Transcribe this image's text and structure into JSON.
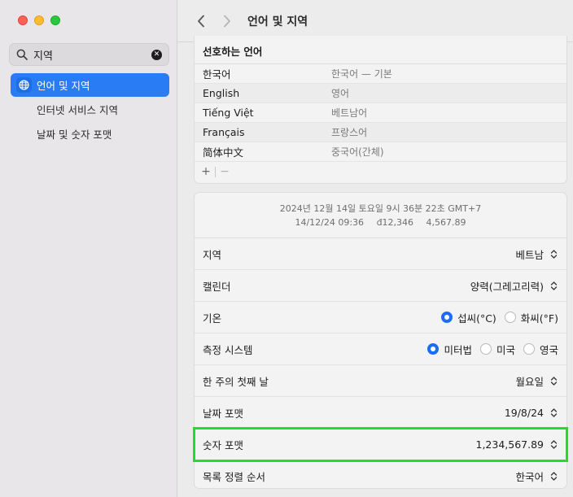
{
  "window": {
    "title": "언어 및 지역"
  },
  "search": {
    "value": "지역",
    "clear_glyph": "✕"
  },
  "sidebar": {
    "items": [
      {
        "label": "언어 및 지역",
        "active": true,
        "icon": "globe-icon"
      },
      {
        "label": "인터넷 서비스 지역",
        "active": false
      },
      {
        "label": "날짜 및 숫자 포맷",
        "active": false
      }
    ]
  },
  "languages": {
    "header": "선호하는 언어",
    "rows": [
      {
        "name": "한국어",
        "sub": "한국어 — 기본"
      },
      {
        "name": "English",
        "sub": "영어"
      },
      {
        "name": "Tiếng Việt",
        "sub": "베트남어"
      },
      {
        "name": "Français",
        "sub": "프랑스어"
      },
      {
        "name": "简体中文",
        "sub": "중국어(간체)"
      }
    ],
    "add_glyph": "+",
    "remove_glyph": "−"
  },
  "preview": {
    "line1": "2024년 12월 14일 토요일 9시 36분 22초 GMT+7",
    "date_short": "14/12/24 09:36",
    "currency": "đ12,346",
    "number": "4,567.89"
  },
  "settings": {
    "region": {
      "label": "지역",
      "value": "베트남"
    },
    "calendar": {
      "label": "캘린더",
      "value": "양력(그레고리력)"
    },
    "temperature": {
      "label": "기온",
      "options": [
        "섭씨(°C)",
        "화씨(°F)"
      ],
      "selected": "섭씨(°C)"
    },
    "measurement": {
      "label": "측정 시스템",
      "options": [
        "미터법",
        "미국",
        "영국"
      ],
      "selected": "미터법"
    },
    "first_day": {
      "label": "한 주의 첫째 날",
      "value": "월요일"
    },
    "date_format": {
      "label": "날짜 포맷",
      "value": "19/8/24"
    },
    "number_format": {
      "label": "숫자 포맷",
      "value": "1,234,567.89"
    },
    "sort_order": {
      "label": "목록 정렬 순서",
      "value": "한국어"
    }
  },
  "colors": {
    "accent": "#1b6ef3",
    "highlight": "#22dd22"
  }
}
